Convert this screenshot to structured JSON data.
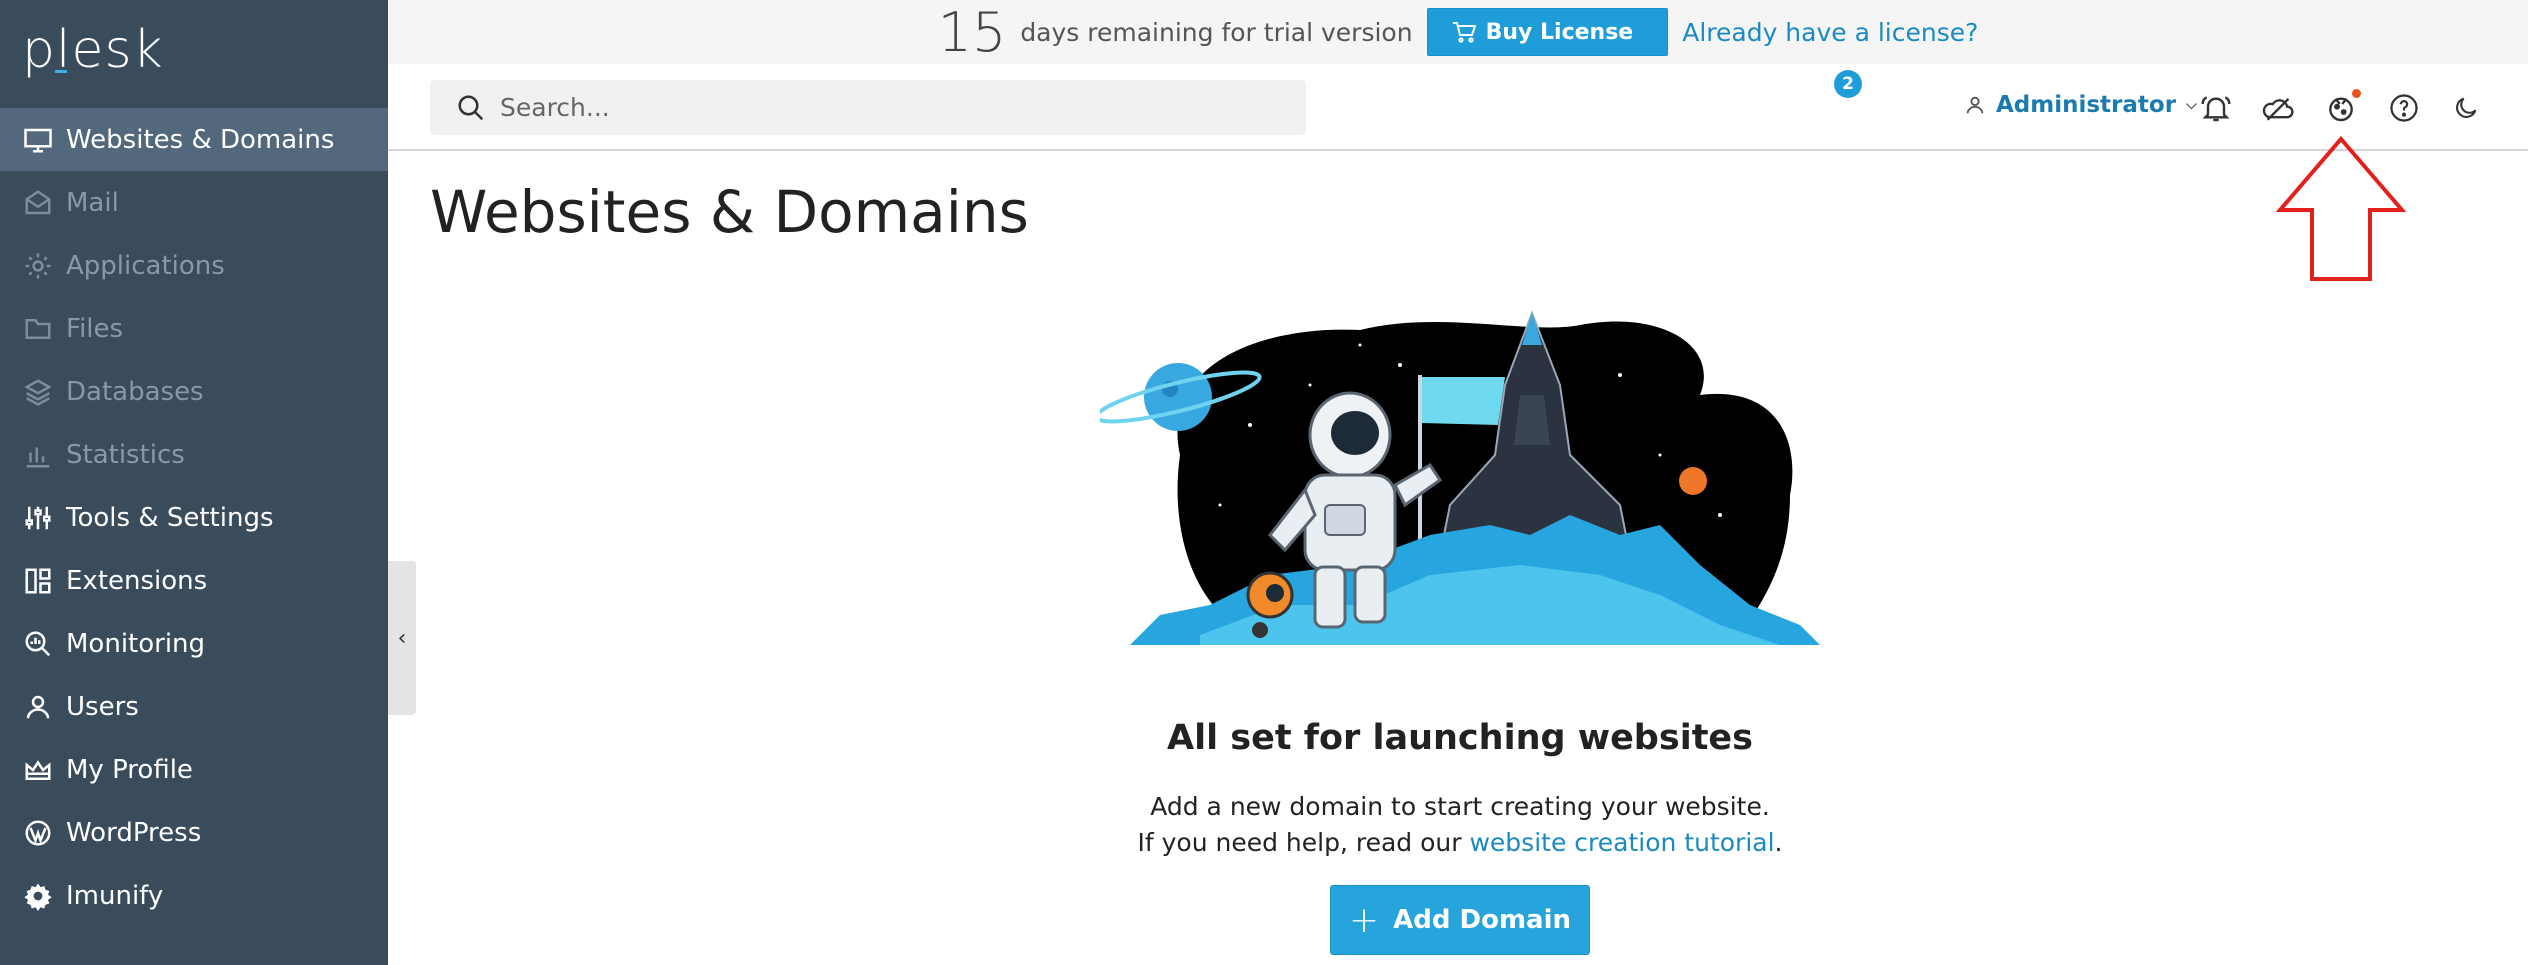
{
  "app": {
    "logo": "plesk"
  },
  "sidebar": {
    "items": [
      {
        "label": "Websites & Domains",
        "icon": "monitor-icon",
        "state": "active"
      },
      {
        "label": "Mail",
        "icon": "mail-icon",
        "state": "disabled"
      },
      {
        "label": "Applications",
        "icon": "gear-icon",
        "state": "disabled"
      },
      {
        "label": "Files",
        "icon": "folder-icon",
        "state": "disabled"
      },
      {
        "label": "Databases",
        "icon": "layers-icon",
        "state": "disabled"
      },
      {
        "label": "Statistics",
        "icon": "bar-chart-icon",
        "state": "disabled"
      },
      {
        "label": "Tools & Settings",
        "icon": "sliders-icon",
        "state": "normal"
      },
      {
        "label": "Extensions",
        "icon": "blocks-icon",
        "state": "normal"
      },
      {
        "label": "Monitoring",
        "icon": "magnifier-chart-icon",
        "state": "normal"
      },
      {
        "label": "Users",
        "icon": "user-icon",
        "state": "normal"
      },
      {
        "label": "My Profile",
        "icon": "crown-icon",
        "state": "normal"
      },
      {
        "label": "WordPress",
        "icon": "wordpress-icon",
        "state": "normal"
      },
      {
        "label": "Imunify",
        "icon": "cog-shield-icon",
        "state": "normal"
      }
    ],
    "collapse_glyph": "‹"
  },
  "trial": {
    "days": "15",
    "text": "days remaining for trial version",
    "buy_label": "Buy License",
    "already_label": "Already have a license?"
  },
  "header": {
    "search_placeholder": "Search...",
    "user_label": "Administrator",
    "notifications_count": "2",
    "icons": [
      "bell-icon",
      "cloud-icon",
      "cookie-icon",
      "help-icon",
      "moon-icon"
    ]
  },
  "main": {
    "title": "Websites & Domains",
    "hero_title": "All set for launching websites",
    "hero_line1": "Add a new domain to start creating your website.",
    "hero_line2_prefix": "If you need help, read our ",
    "hero_link": "website creation tutorial",
    "hero_line2_suffix": ".",
    "add_domain_label": "Add Domain"
  },
  "colors": {
    "sidebar_bg": "#3a4b5c",
    "sidebar_active": "#53687c",
    "accent": "#1e9dd8",
    "link": "#1b8ac3",
    "annotation": "#e3201b"
  }
}
